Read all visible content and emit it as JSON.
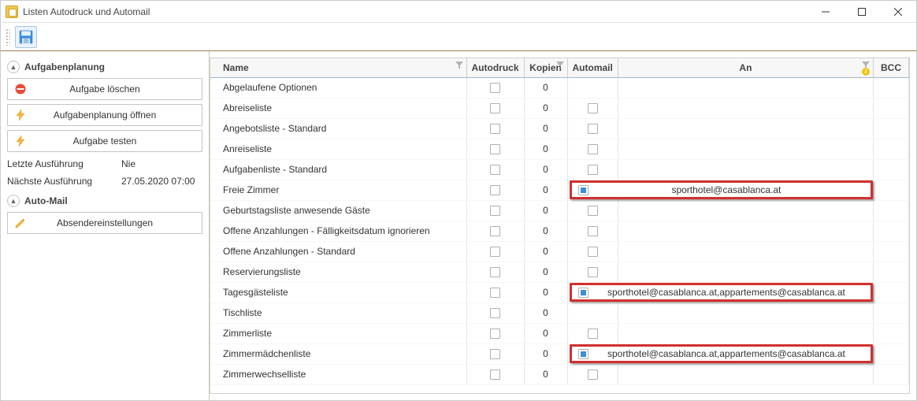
{
  "window": {
    "title": "Listen Autodruck und Automail"
  },
  "sidebar": {
    "sections": {
      "tasks": {
        "title": "Aufgabenplanung",
        "buttons": {
          "delete": "Aufgabe löschen",
          "open": "Aufgabenplanung öffnen",
          "test": "Aufgabe testen"
        }
      },
      "automail": {
        "title": "Auto-Mail",
        "buttons": {
          "sender": "Absendereinstellungen"
        }
      }
    },
    "info": {
      "last_label": "Letzte Ausführung",
      "last_value": "Nie",
      "next_label": "Nächste Ausführung",
      "next_value": "27.05.2020 07:00"
    }
  },
  "grid": {
    "columns": {
      "name": "Name",
      "autodruck": "Autodruck",
      "kopien": "Kopien",
      "automail": "Automail",
      "an": "An",
      "bcc": "BCC"
    },
    "rows": [
      {
        "name": "Abgelaufene Optionen",
        "autodruck": false,
        "kopien": 0,
        "automail": null,
        "an": "",
        "hl": false
      },
      {
        "name": "Abreiseliste",
        "autodruck": false,
        "kopien": 0,
        "automail": false,
        "an": "",
        "hl": false
      },
      {
        "name": "Angebotsliste - Standard",
        "autodruck": false,
        "kopien": 0,
        "automail": false,
        "an": "",
        "hl": false
      },
      {
        "name": "Anreiseliste",
        "autodruck": false,
        "kopien": 0,
        "automail": false,
        "an": "",
        "hl": false
      },
      {
        "name": "Aufgabenliste - Standard",
        "autodruck": false,
        "kopien": 0,
        "automail": false,
        "an": "",
        "hl": false
      },
      {
        "name": "Freie Zimmer",
        "autodruck": false,
        "kopien": 0,
        "automail": true,
        "an": "sporthotel@casablanca.at",
        "hl": true
      },
      {
        "name": "Geburtstagsliste anwesende Gäste",
        "autodruck": false,
        "kopien": 0,
        "automail": false,
        "an": "",
        "hl": false
      },
      {
        "name": "Offene Anzahlungen - Fälligkeitsdatum ignorieren",
        "autodruck": false,
        "kopien": 0,
        "automail": false,
        "an": "",
        "hl": false
      },
      {
        "name": "Offene Anzahlungen - Standard",
        "autodruck": false,
        "kopien": 0,
        "automail": false,
        "an": "",
        "hl": false
      },
      {
        "name": "Reservierungsliste",
        "autodruck": false,
        "kopien": 0,
        "automail": false,
        "an": "",
        "hl": false
      },
      {
        "name": "Tagesgästeliste",
        "autodruck": false,
        "kopien": 0,
        "automail": true,
        "an": "sporthotel@casablanca.at,appartements@casablanca.at",
        "hl": true
      },
      {
        "name": "Tischliste",
        "autodruck": false,
        "kopien": 0,
        "automail": null,
        "an": "",
        "hl": false
      },
      {
        "name": "Zimmerliste",
        "autodruck": false,
        "kopien": 0,
        "automail": false,
        "an": "",
        "hl": false
      },
      {
        "name": "Zimmermädchenliste",
        "autodruck": false,
        "kopien": 0,
        "automail": true,
        "an": "sporthotel@casablanca.at,appartements@casablanca.at",
        "hl": true
      },
      {
        "name": "Zimmerwechselliste",
        "autodruck": false,
        "kopien": 0,
        "automail": false,
        "an": "",
        "hl": false
      }
    ]
  }
}
